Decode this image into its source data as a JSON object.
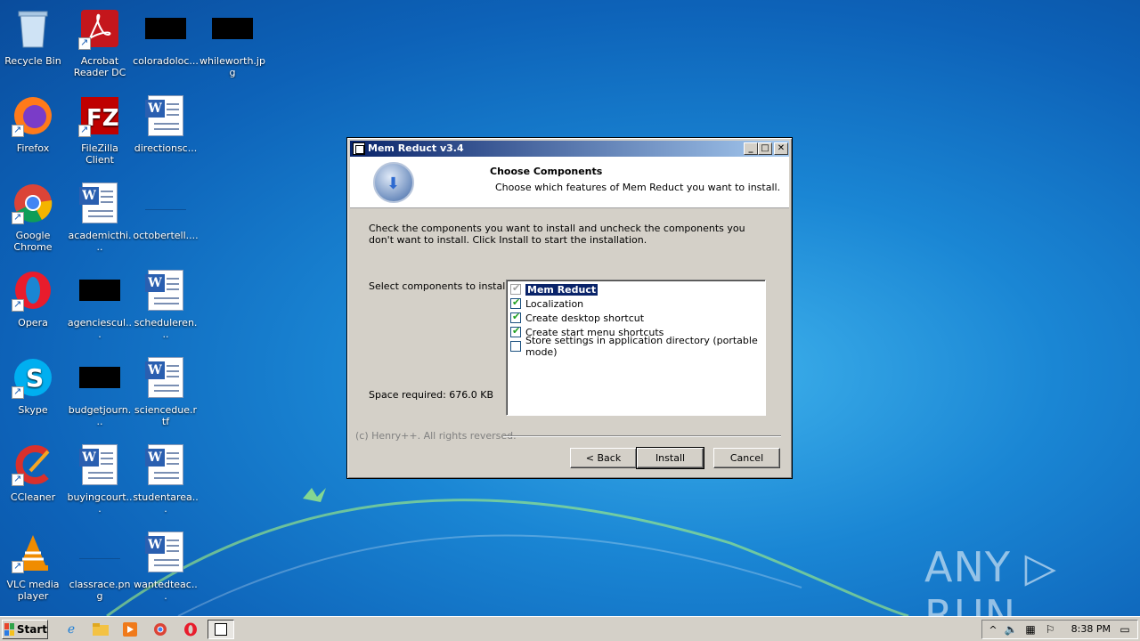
{
  "desktop": {
    "icons": [
      {
        "label": "Recycle Bin"
      },
      {
        "label": "Acrobat Reader DC"
      },
      {
        "label": "coloradoloc..."
      },
      {
        "label": "whileworth.jpg"
      },
      {
        "label": "Firefox"
      },
      {
        "label": "FileZilla Client"
      },
      {
        "label": "directionsc..."
      },
      {
        "label": "Google Chrome"
      },
      {
        "label": "academicthi..."
      },
      {
        "label": "octobertell...."
      },
      {
        "label": "Opera"
      },
      {
        "label": "agenciescul..."
      },
      {
        "label": "scheduleren..."
      },
      {
        "label": "Skype"
      },
      {
        "label": "budgetjourn..."
      },
      {
        "label": "sciencedue.rtf"
      },
      {
        "label": "CCleaner"
      },
      {
        "label": "buyingcourt..."
      },
      {
        "label": "studentarea..."
      },
      {
        "label": "VLC media player"
      },
      {
        "label": "classrace.png"
      },
      {
        "label": "wantedteac..."
      }
    ],
    "watermark": "ANY ▷ RUN"
  },
  "dialog": {
    "title": "Mem Reduct v3.4",
    "header_title": "Choose Components",
    "header_subtitle": "Choose which features of Mem Reduct you want to install.",
    "description": "Check the components you want to install and uncheck the components you don't want to install. Click Install to start the installation.",
    "select_label": "Select components to install:",
    "space_required": "Space required: 676.0 KB",
    "components": [
      {
        "label": "Mem Reduct",
        "checked": true,
        "disabled": true
      },
      {
        "label": "Localization",
        "checked": true
      },
      {
        "label": "Create desktop shortcut",
        "checked": true
      },
      {
        "label": "Create start menu shortcuts",
        "checked": true
      },
      {
        "label": "Store settings in application directory (portable mode)",
        "checked": false
      }
    ],
    "branding": "(c) Henry++. All rights reversed.",
    "buttons": {
      "back": "< Back",
      "install": "Install",
      "cancel": "Cancel"
    }
  },
  "taskbar": {
    "start_label": "Start",
    "clock": "8:38 PM"
  }
}
